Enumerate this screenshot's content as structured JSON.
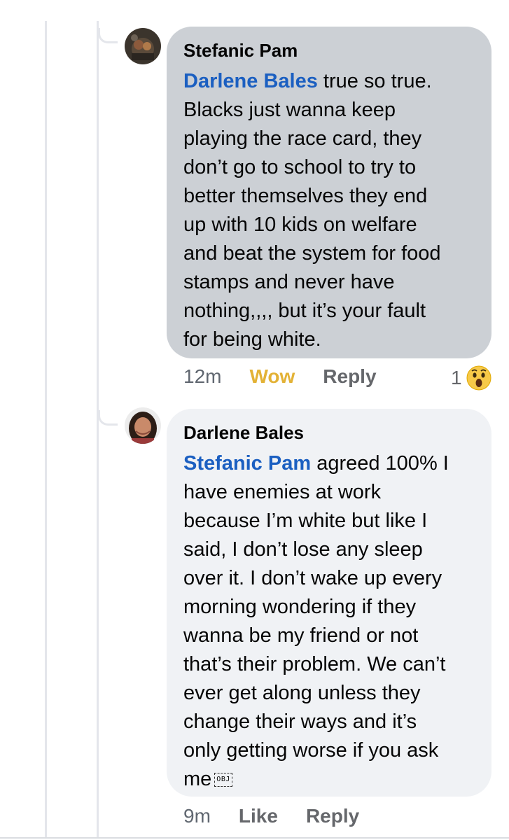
{
  "comments": [
    {
      "author": "Stefanic Pam",
      "mention": "Darlene Bales",
      "text": " true so true.\nBlacks just wanna keep\nplaying the race card, they\ndon’t  go to school to try to\nbetter themselves they end\nup with 10 kids on welfare\nand beat the system for food\nstamps and never have\nnothing,,,, but it’s your fault\nfor being white.",
      "time": "12m",
      "reaction_label": "Wow",
      "reply_label": "Reply",
      "reaction_count": "1",
      "reaction_icon": "wow-emoji-icon"
    },
    {
      "author": "Darlene Bales",
      "mention": "Stefanic Pam",
      "text": " agreed 100% I\nhave enemies at work\nbecause I’m white but like I\nsaid, I don’t lose any sleep\nover it. I don’t wake up every\nmorning wondering if they\nwanna be my friend or not\nthat’s their problem. We can’t\never get along unless they\nchange their ways and it’s\nonly getting worse if you ask\nme",
      "obj_glyph": "OBJ",
      "time": "9m",
      "like_label": "Like",
      "reply_label": "Reply"
    }
  ],
  "colors": {
    "mention": "#1b5fc1",
    "wow": "#e3b236",
    "bubble_dark": "#ccd0d5",
    "bubble_light": "#f0f2f5"
  }
}
